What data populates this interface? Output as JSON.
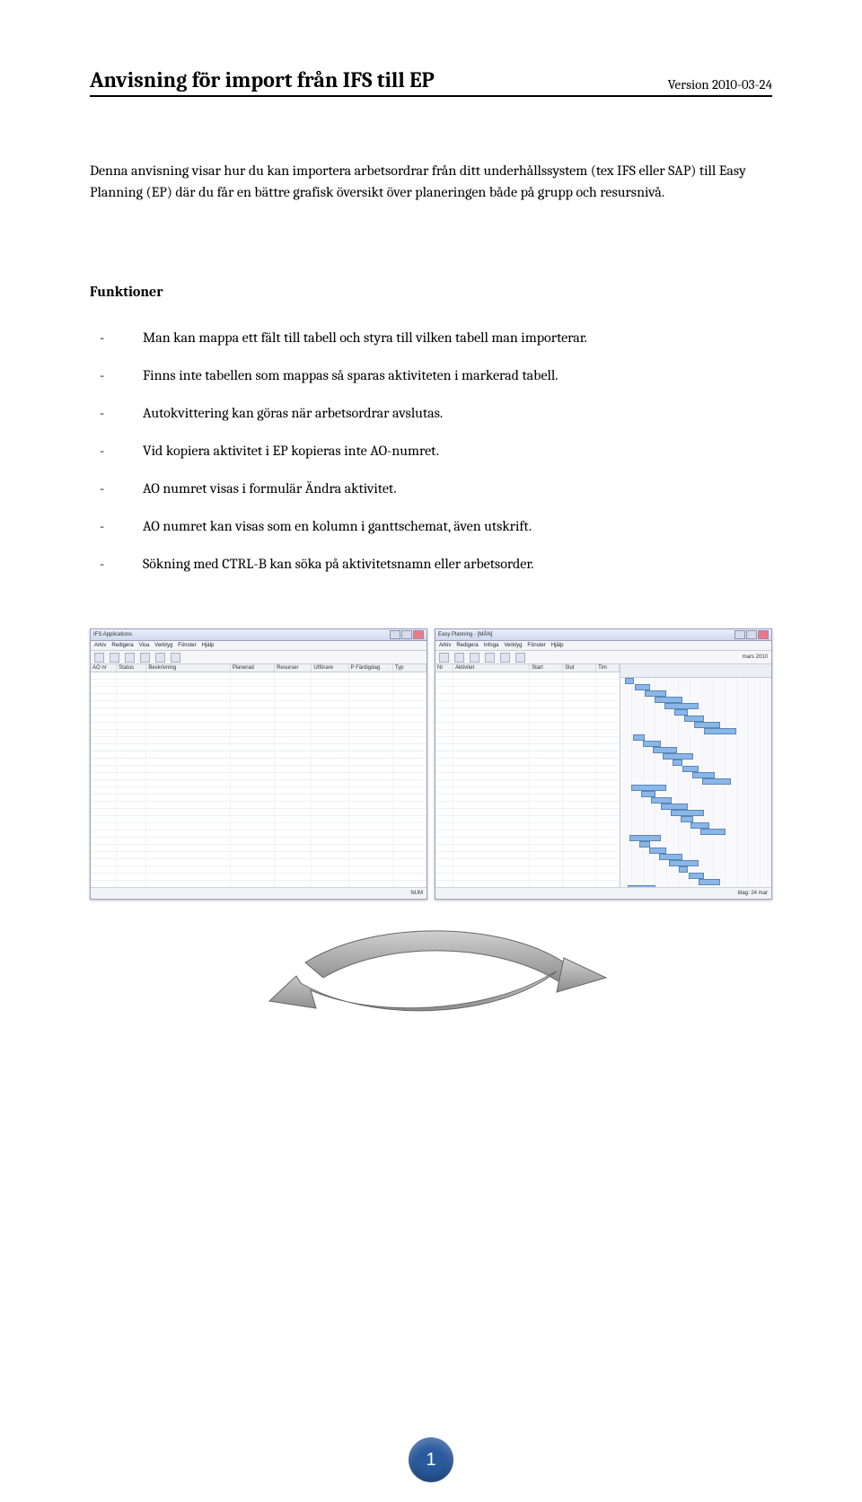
{
  "header": {
    "title": "Anvisning för import från IFS till EP",
    "version": "Version 2010-03-24"
  },
  "intro": "Denna anvisning visar hur du kan importera arbetsordrar från ditt underhållssystem (tex IFS eller SAP) till Easy Planning (EP) där du får en bättre grafisk översikt över planeringen både på grupp och resursnivå.",
  "section_heading": "Funktioner",
  "functions": [
    "Man kan mappa ett fält till tabell och styra till vilken tabell man importerar.",
    "Finns inte tabellen som mappas så sparas aktiviteten i markerad tabell.",
    "Autokvittering kan göras när arbetsordrar avslutas.",
    "Vid kopiera aktivitet i EP kopieras inte AO-numret.",
    "AO numret visas i formulär Ändra aktivitet.",
    "AO numret kan visas som en kolumn i ganttschemat, även utskrift.",
    "Sökning med CTRL-B kan söka på aktivitetsnamn eller arbetsorder."
  ],
  "left_window": {
    "title": "IFS Applications",
    "menus": [
      "Arkiv",
      "Redigera",
      "Visa",
      "Verktyg",
      "Fönster",
      "Hjälp"
    ],
    "columns": [
      "AO nr",
      "Status",
      "Beskrivning",
      "Planerad",
      "Resurser",
      "Utförare",
      "P Färdigdag",
      "Typ"
    ],
    "status_left": "",
    "status_right": "NUM"
  },
  "right_window": {
    "title": "Easy Planning - [MÅN]",
    "menus": [
      "Arkiv",
      "Redigera",
      "Infoga",
      "Verktyg",
      "Fönster",
      "Hjälp"
    ],
    "timeline_label": "mars 2010",
    "columns": [
      "Nr",
      "Aktivitet",
      "Start",
      "Slut",
      "Tim"
    ],
    "status_left": "",
    "status_right": "Idag: 24 mar"
  },
  "page_number": "1"
}
